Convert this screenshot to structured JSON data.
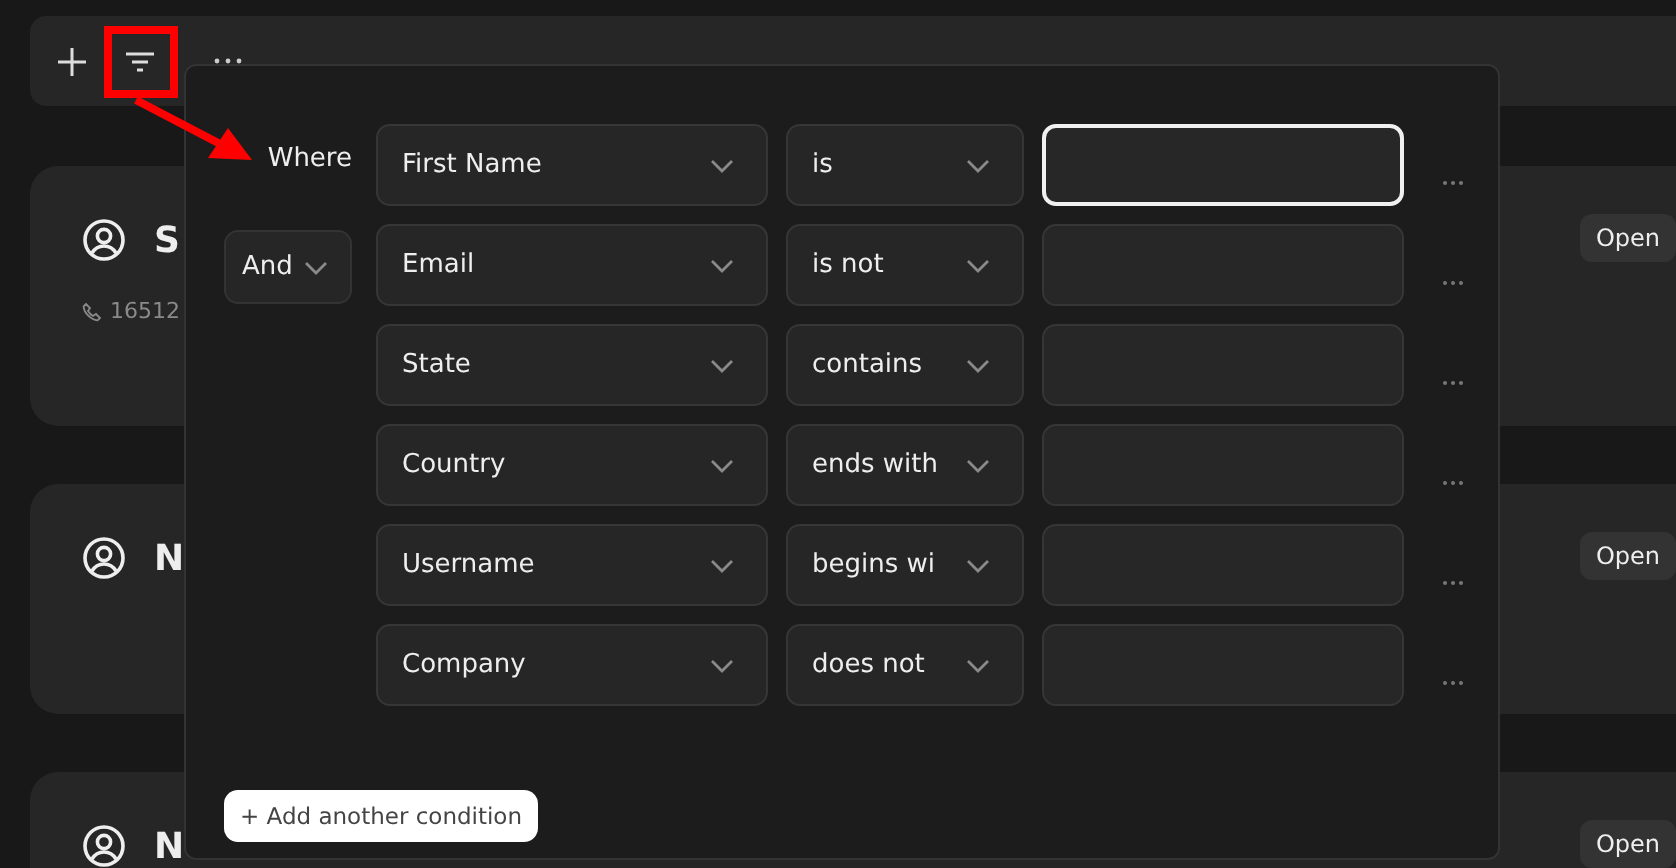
{
  "cards": [
    {
      "name": "S",
      "phone": "16512",
      "action": "Open"
    },
    {
      "name": "N",
      "action": "Open"
    },
    {
      "name": "N",
      "action": "Open"
    }
  ],
  "filter": {
    "conditions": [
      {
        "kind": "where",
        "connector": "Where",
        "field": "First Name",
        "operator": "is",
        "focused": true
      },
      {
        "kind": "join",
        "connector": "And",
        "field": "Email",
        "operator": "is not",
        "focused": false
      },
      {
        "kind": "plain",
        "field": "State",
        "operator": "contains",
        "focused": false
      },
      {
        "kind": "plain",
        "field": "Country",
        "operator": "ends with",
        "focused": false
      },
      {
        "kind": "plain",
        "field": "Username",
        "operator": "begins wi",
        "focused": false
      },
      {
        "kind": "plain",
        "field": "Company",
        "operator": "does not",
        "focused": false
      }
    ],
    "add_button": "+ Add another condition"
  }
}
